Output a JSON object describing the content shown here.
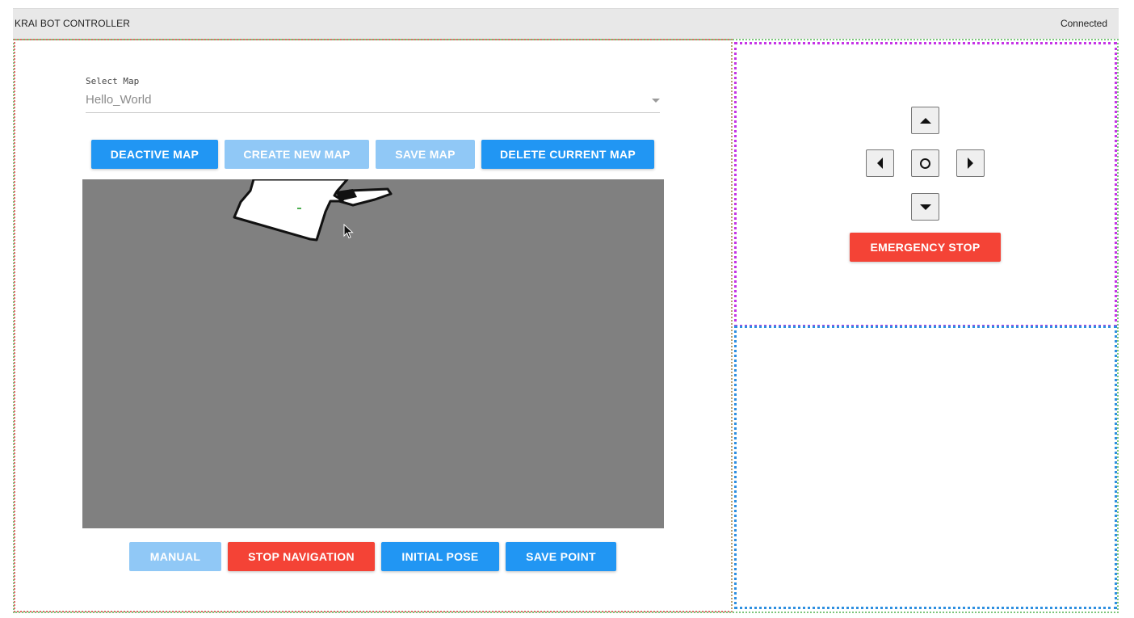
{
  "header": {
    "title": "KRAI BOT CONTROLLER",
    "status": "Connected"
  },
  "map_select": {
    "label": "Select Map",
    "value": "Hello_World",
    "icon": "caret-down-icon"
  },
  "map_toolbar": {
    "deactive": "DEACTIVE MAP",
    "create": "CREATE NEW MAP",
    "save": "SAVE MAP",
    "delete": "DELETE CURRENT MAP"
  },
  "nav_toolbar": {
    "manual": "MANUAL",
    "stop_navigation": "STOP NAVIGATION",
    "initial_pose": "INITIAL POSE",
    "save_point": "SAVE POINT"
  },
  "control_pad": {
    "up": "arrow-up-icon",
    "down": "arrow-down-icon",
    "left": "arrow-left-icon",
    "right": "arrow-right-icon",
    "center": "circle-icon",
    "emergency_stop": "EMERGENCY STOP"
  },
  "colors": {
    "primary": "#2196f3",
    "primary_disabled": "#90c8f6",
    "danger": "#f44336",
    "map_unknown": "#808080",
    "header_bg": "#e8e8e8"
  }
}
